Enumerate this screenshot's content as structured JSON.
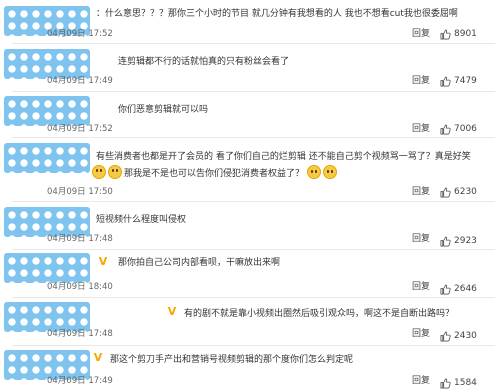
{
  "comments": [
    {
      "text": "：什么意思？？？那你三个小时的节目 就几分钟有我想看的人 我也不想看cut我也很委屈啊",
      "date": "04月09日 17:52",
      "reply_label": "回复",
      "likes": "8901",
      "avatar_badge": ""
    },
    {
      "text": "连剪辑都不行的话就怕真的只有粉丝会看了",
      "date": "04月09日 17:49",
      "reply_label": "回复",
      "likes": "7479",
      "avatar_badge": ""
    },
    {
      "text": "你们恶意剪辑就可以吗",
      "date": "04月09日 17:52",
      "reply_label": "回复",
      "likes": "7006",
      "avatar_badge": ""
    },
    {
      "text": "有些消费者也都是开了会员的 看了你们自己的烂剪辑 还不能自己剪个视频骂一骂了？真是好笑",
      "text2": "那我是不是也可以告你们侵犯消费者权益了？",
      "date": "04月09日 17:50",
      "reply_label": "回复",
      "likes": "6230",
      "avatar_badge": ""
    },
    {
      "text": "短视频什么程度叫侵权",
      "date": "04月09日 17:48",
      "reply_label": "回复",
      "likes": "2923",
      "avatar_badge": ""
    },
    {
      "text": "那你拍自己公司内部看呗，干嘛放出来啊",
      "date": "04月09日 18:40",
      "reply_label": "回复",
      "likes": "2646",
      "avatar_badge": "V"
    },
    {
      "text": "有的剧不就是靠小视频出圈然后吸引观众吗，啊这不是自断出路吗？",
      "date": "04月09日 17:48",
      "reply_label": "回复",
      "likes": "2430",
      "avatar_badge": "V"
    },
    {
      "text": "那这个剪刀手产出和营销号视频剪辑的那个度你们怎么判定呢",
      "date": "04月09日 17:49",
      "reply_label": "回复",
      "likes": "1584",
      "avatar_badge": "V"
    }
  ],
  "icons": {
    "like": "thumbs-up-icon",
    "emoji": "emoji-icon",
    "verified": "verified-badge-icon"
  },
  "colors": {
    "avatar_blue": "#7ec4ee",
    "verified_gold": "#f2a800",
    "text": "#333333",
    "meta": "#666666"
  }
}
